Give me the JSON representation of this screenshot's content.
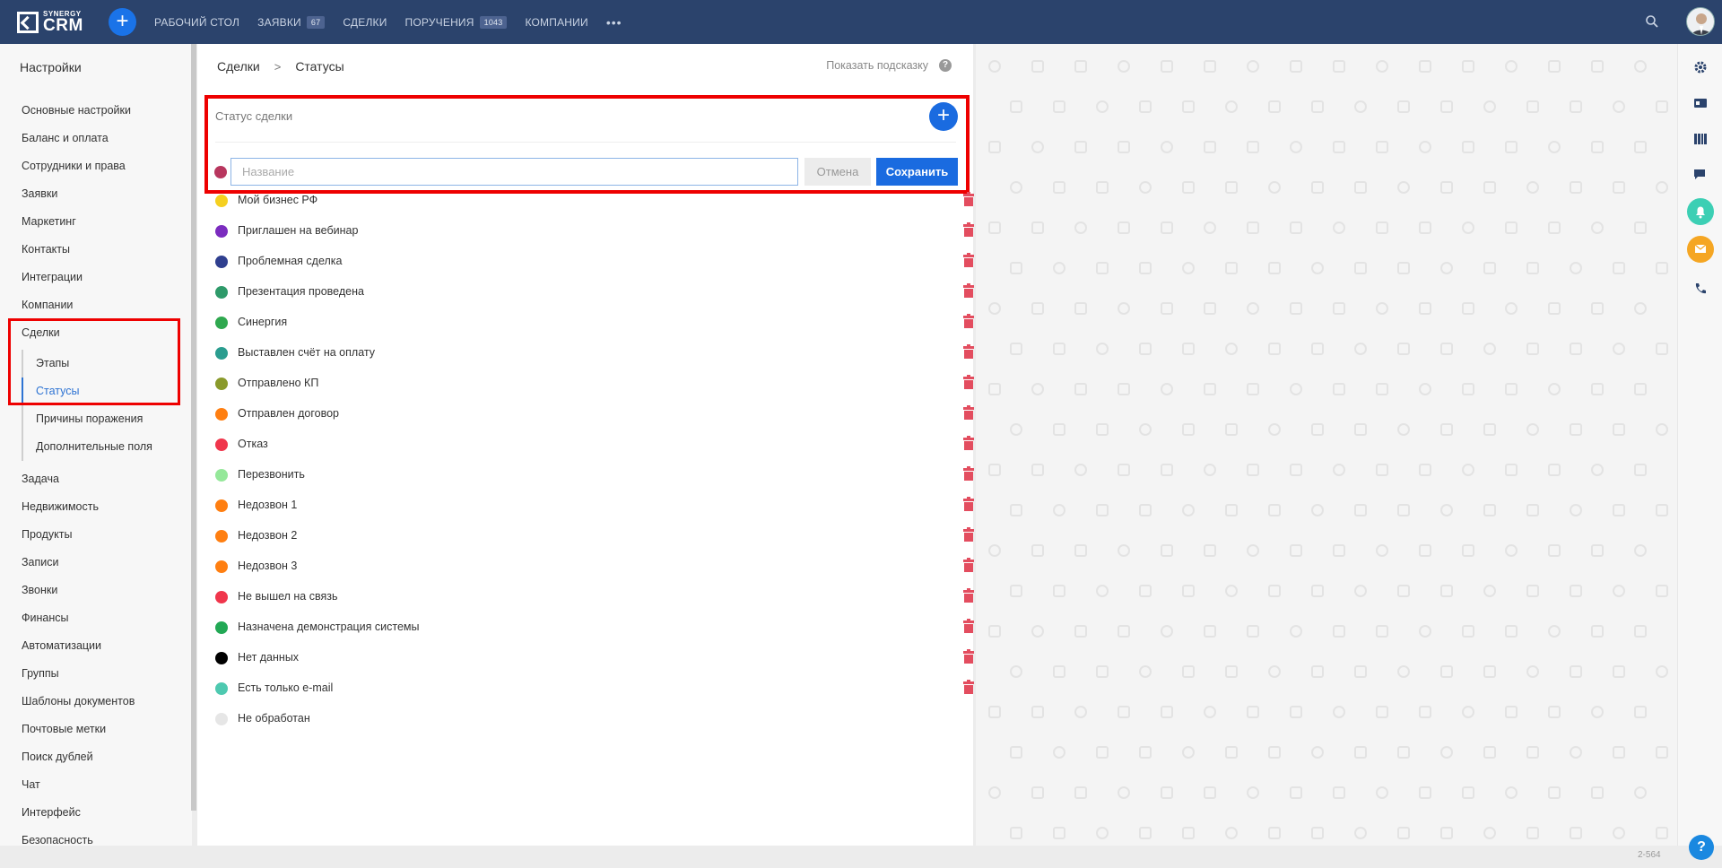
{
  "topbar": {
    "logo_small": "SYNERGY",
    "logo_large": "CRM",
    "nav": [
      {
        "label": "РАБОЧИЙ СТОЛ",
        "badge": null
      },
      {
        "label": "ЗАЯВКИ",
        "badge": "67"
      },
      {
        "label": "СДЕЛКИ",
        "badge": null
      },
      {
        "label": "ПОРУЧЕНИЯ",
        "badge": "1043"
      },
      {
        "label": "КОМПАНИИ",
        "badge": null
      }
    ],
    "more": "•••"
  },
  "sidebar": {
    "title": "Настройки",
    "items": [
      "Основные настройки",
      "Баланс и оплата",
      "Сотрудники и права",
      "Заявки",
      "Маркетинг",
      "Контакты",
      "Интеграции",
      "Компании",
      "Сделки"
    ],
    "subitems": [
      "Этапы",
      "Статусы",
      "Причины поражения",
      "Дополнительные поля"
    ],
    "items_after": [
      "Задача",
      "Недвижимость",
      "Продукты",
      "Записи",
      "Звонки",
      "Финансы",
      "Автоматизации",
      "Группы",
      "Шаблоны документов",
      "Почтовые метки",
      "Поиск дублей",
      "Чат",
      "Интерфейс",
      "Безопасность"
    ]
  },
  "main": {
    "breadcrumb": [
      "Сделки",
      "Статусы"
    ],
    "breadcrumb_sep": ">",
    "hint_label": "Показать подсказку",
    "hint_icon": "?",
    "panel_title": "Статус сделки",
    "input_placeholder": "Название",
    "cancel_label": "Отмена",
    "save_label": "Сохранить",
    "new_status_color": "#b8365e",
    "statuses": [
      {
        "label": "Мой бизнес РФ",
        "color": "#f5d020",
        "deletable": true
      },
      {
        "label": "Приглашен на вебинар",
        "color": "#7b2cbf",
        "deletable": true
      },
      {
        "label": "Проблемная сделка",
        "color": "#2f3f8f",
        "deletable": true
      },
      {
        "label": "Презентация проведена",
        "color": "#2e9a6a",
        "deletable": true
      },
      {
        "label": "Синергия",
        "color": "#2fa84f",
        "deletable": true
      },
      {
        "label": "Выставлен счёт на оплату",
        "color": "#2a9d8f",
        "deletable": true
      },
      {
        "label": "Отправлено КП",
        "color": "#8a9a2b",
        "deletable": true
      },
      {
        "label": "Отправлен договор",
        "color": "#ff7f11",
        "deletable": true
      },
      {
        "label": "Отказ",
        "color": "#f0364c",
        "deletable": true
      },
      {
        "label": "Перезвонить",
        "color": "#95e89a",
        "deletable": true
      },
      {
        "label": "Недозвон 1",
        "color": "#ff7f11",
        "deletable": true
      },
      {
        "label": "Недозвон 2",
        "color": "#ff7f11",
        "deletable": true
      },
      {
        "label": "Недозвон 3",
        "color": "#ff7f11",
        "deletable": true
      },
      {
        "label": "Не вышел на связь",
        "color": "#f0364c",
        "deletable": true
      },
      {
        "label": "Назначена демонстрация системы",
        "color": "#22a855",
        "deletable": true
      },
      {
        "label": "Нет данных",
        "color": "#000000",
        "deletable": true
      },
      {
        "label": "Есть только e-mail",
        "color": "#4ec9b0",
        "deletable": true
      },
      {
        "label": "Не обработан",
        "color": "#e6e6e6",
        "deletable": false
      }
    ]
  },
  "footer": {
    "version": "2-564"
  },
  "colors": {
    "topbar": "#2b436c",
    "accent": "#1a6be0",
    "highlight": "#ee0000",
    "delete": "#e34d5f"
  }
}
